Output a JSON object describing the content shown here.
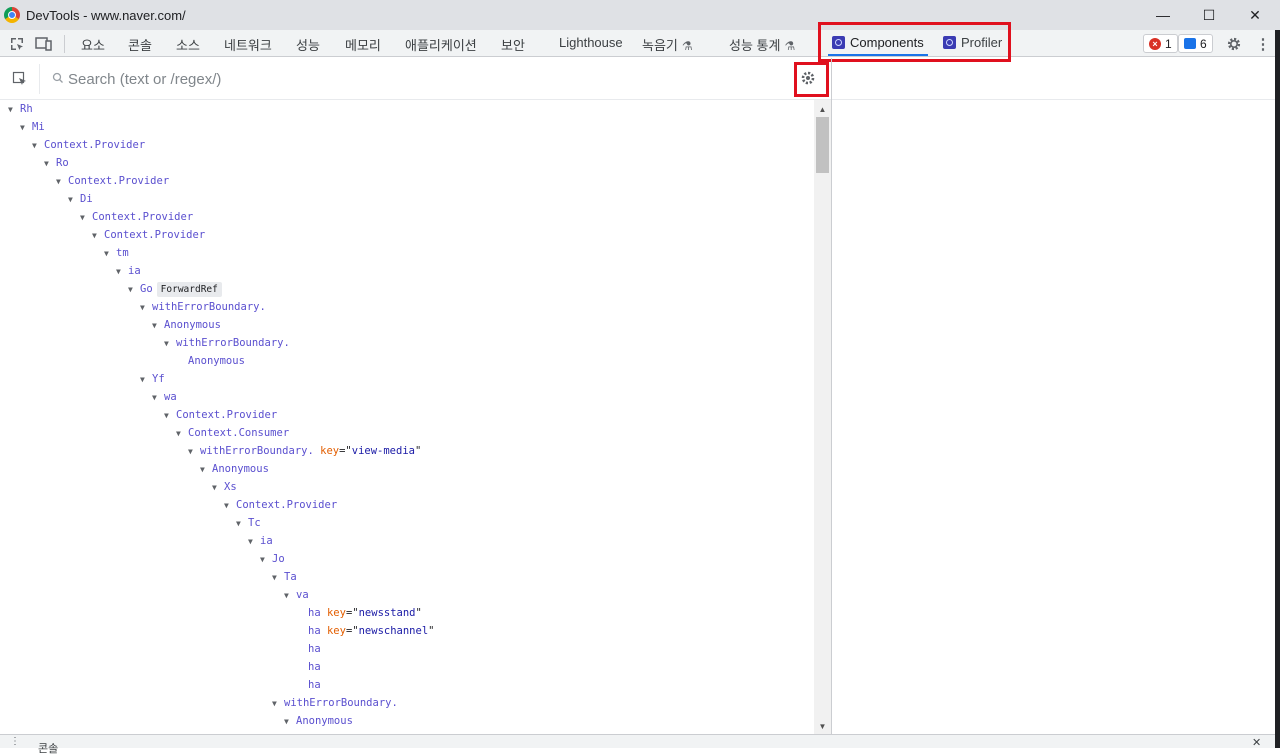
{
  "window": {
    "title": "DevTools - www.naver.com/",
    "minimize": "—",
    "maximize": "☐",
    "close": "✕"
  },
  "toolbar": {
    "tabs": [
      "요소",
      "콘솔",
      "소스",
      "네트워크",
      "성능",
      "메모리",
      "애플리케이션",
      "보안",
      "Lighthouse",
      "녹음기",
      "성능 통계",
      "Components",
      "Profiler"
    ],
    "active_tab": "Components",
    "errors_count": "1",
    "messages_count": "6",
    "settings_icon": "gear-icon",
    "more_icon": "kebab-icon"
  },
  "search": {
    "placeholder": "Search (text or /regex/)",
    "value": ""
  },
  "tree": [
    {
      "name": "Rh"
    },
    {
      "name": "Mi"
    },
    {
      "name": "Context.Provider"
    },
    {
      "name": "Ro"
    },
    {
      "name": "Context.Provider"
    },
    {
      "name": "Di"
    },
    {
      "name": "Context.Provider"
    },
    {
      "name": "Context.Provider"
    },
    {
      "name": "tm"
    },
    {
      "name": "ia"
    },
    {
      "name": "Go",
      "badge": "ForwardRef"
    },
    {
      "name": "withErrorBoundary."
    },
    {
      "name": "Anonymous"
    },
    {
      "name": "withErrorBoundary."
    },
    {
      "name": "Anonymous"
    },
    {
      "name": "Yf"
    },
    {
      "name": "wa"
    },
    {
      "name": "Context.Provider"
    },
    {
      "name": "Context.Consumer"
    },
    {
      "name": "withErrorBoundary.",
      "key": "view-media"
    },
    {
      "name": "Anonymous"
    },
    {
      "name": "Xs"
    },
    {
      "name": "Context.Provider"
    },
    {
      "name": "Tc"
    },
    {
      "name": "ia"
    },
    {
      "name": "Jo"
    },
    {
      "name": "Ta"
    },
    {
      "name": "va"
    },
    {
      "name": "ha",
      "key": "newsstand"
    },
    {
      "name": "ha",
      "key": "newschannel"
    },
    {
      "name": "ha"
    },
    {
      "name": "ha"
    },
    {
      "name": "ha"
    },
    {
      "name": "withErrorBoundary."
    },
    {
      "name": "Anonymous"
    }
  ],
  "drawer": {
    "label": "콘솔"
  }
}
